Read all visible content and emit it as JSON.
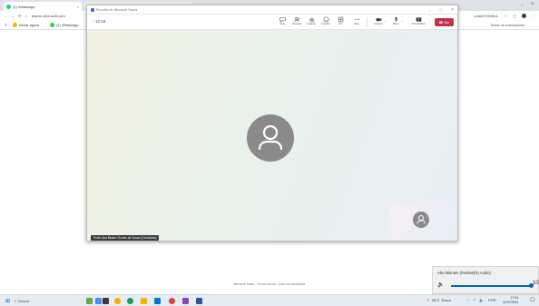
{
  "browser": {
    "tabs": [
      {
        "label": "(1) WhatsApp"
      },
      {
        "label": "Reunião de Microsoft Teams"
      },
      {
        "label": ""
      }
    ],
    "address_text": "teams.microsoft.com",
    "right_tab_text": "cola/0?Obtiti A...",
    "bookmarks": [
      {
        "label": "Iniciar agora"
      },
      {
        "label": "(1) WhatsApp"
      }
    ],
    "bookmark_right": "Todos os marcadores"
  },
  "meeting": {
    "window_title": "Reunião de Microsoft Teams",
    "timer": "12:18",
    "toolbar": [
      {
        "label": "Chat",
        "icon": "chat-icon"
      },
      {
        "label": "Pessoas",
        "icon": "people-icon"
      },
      {
        "label": "Levantar",
        "icon": "hand-icon"
      },
      {
        "label": "Reação",
        "icon": "react-icon"
      },
      {
        "label": "Ver",
        "icon": "view-icon"
      },
      {
        "label": "Mais",
        "icon": "more-icon"
      },
      {
        "label": "Câmera",
        "icon": "camera-icon"
      },
      {
        "label": "Micro",
        "icon": "mic-icon"
      },
      {
        "label": "Compartilhar",
        "icon": "share-icon"
      }
    ],
    "leave_label": "Sair",
    "name_label": "Profa. Ana Beatriz Gomes de Souza (Convidado)"
  },
  "footer_text": "Microsoft Teams · Termos de uso · Aviso de privacidade",
  "volume": {
    "device": "Alto-falantes (Realtek(R) Audio)",
    "level": 100,
    "level_text": "100"
  },
  "taskbar": {
    "search_placeholder": "Buscar",
    "weather": "28°C",
    "weather_label": "Ensol.",
    "lang": "POR",
    "time": "17:04",
    "date": "11/07/2024"
  },
  "colors": {
    "leave_red": "#c4314b",
    "avatar_gray": "#8a8a8a",
    "slider_blue": "#0067c0"
  }
}
